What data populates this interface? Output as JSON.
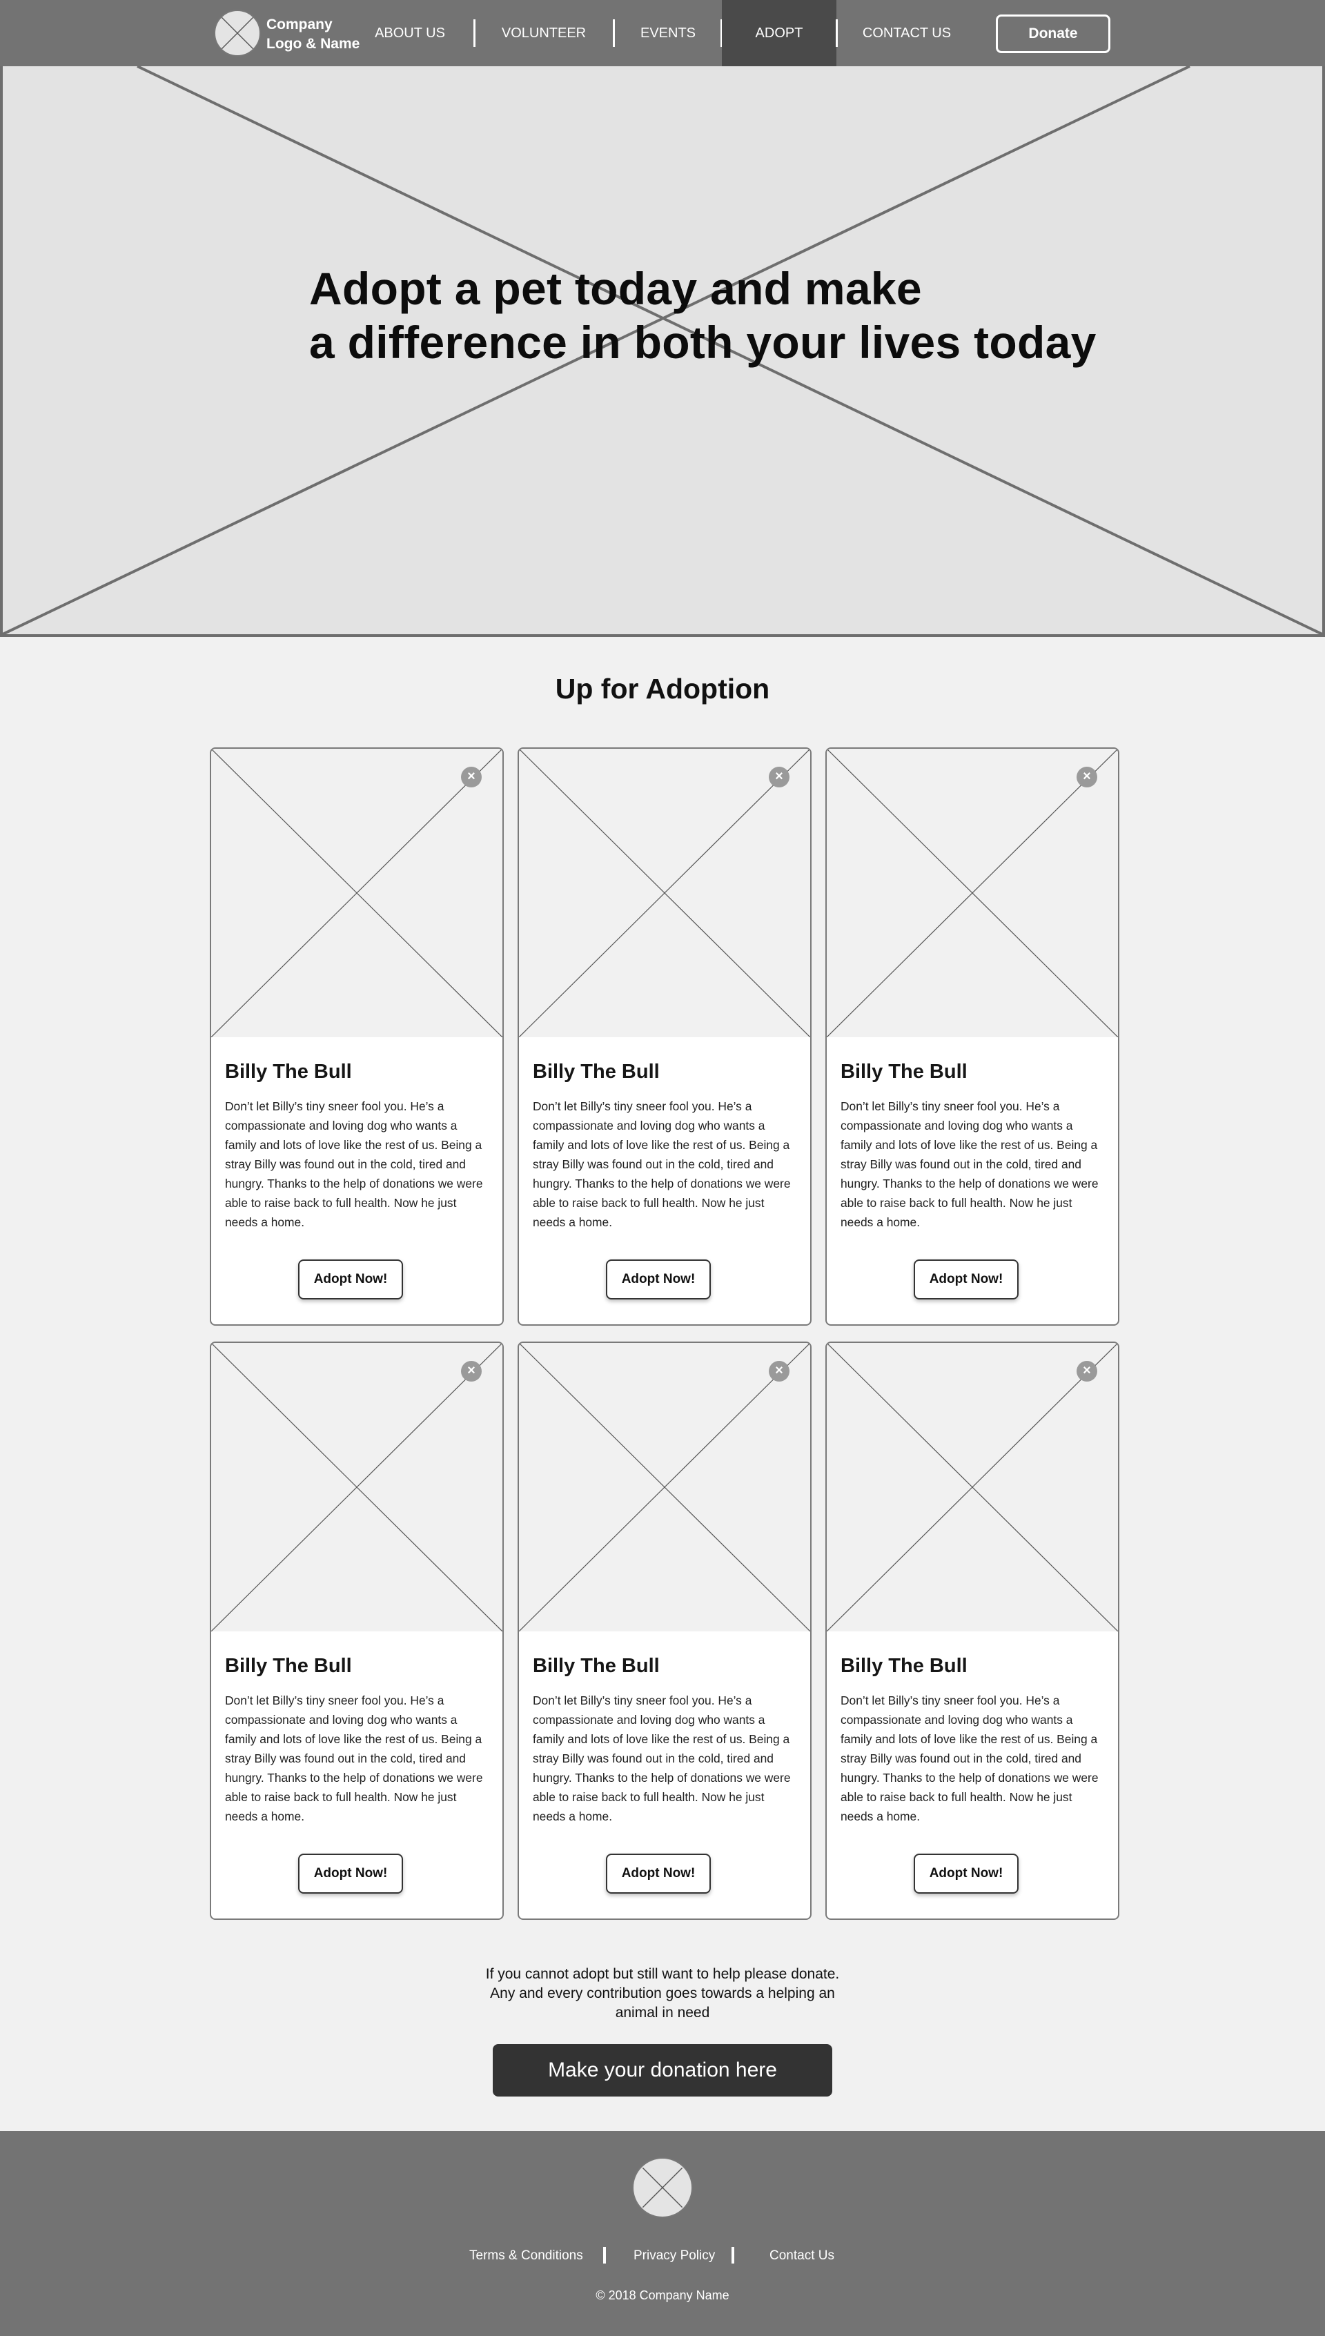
{
  "nav": {
    "logo_text": "Company Logo & Name",
    "items": [
      {
        "label": "ABOUT US"
      },
      {
        "label": "VOLUNTEER"
      },
      {
        "label": "EVENTS"
      },
      {
        "label": "ADOPT",
        "active": true
      },
      {
        "label": "CONTACT US"
      }
    ],
    "donate_label": "Donate"
  },
  "hero": {
    "title_line1": "Adopt a pet today and make",
    "title_line2": "a difference in both your lives today"
  },
  "adoption": {
    "section_title": "Up for Adoption",
    "cards": [
      {
        "name": "Billy The Bull",
        "description": "Don’t let Billy’s tiny sneer fool you. He’s a compassionate and loving dog who wants a family and lots of love like the rest of us. Being a stray Billy was found out in the cold, tired and hungry. Thanks to the help of donations we were able to raise back to full health. Now he just needs a home.",
        "button": "Adopt Now!"
      },
      {
        "name": "Billy The Bull",
        "description": "Don’t let Billy’s tiny sneer fool you. He’s a compassionate and loving dog who wants a family and lots of love like the rest of us. Being a stray Billy was found out in the cold, tired and hungry. Thanks to the help of donations we were able to raise back to full health. Now he just needs a home.",
        "button": "Adopt Now!"
      },
      {
        "name": "Billy The Bull",
        "description": "Don’t let Billy’s tiny sneer fool you. He’s a compassionate and loving dog who wants a family and lots of love like the rest of us. Being a stray Billy was found out in the cold, tired and hungry. Thanks to the help of donations we were able to raise back to full health. Now he just needs a home.",
        "button": "Adopt Now!"
      },
      {
        "name": "Billy The Bull",
        "description": "Don’t let Billy’s tiny sneer fool you. He’s a compassionate and loving dog who wants a family and lots of love like the rest of us. Being a stray Billy was found out in the cold, tired and hungry. Thanks to the help of donations we were able to raise back to full health. Now he just needs a home.",
        "button": "Adopt Now!"
      },
      {
        "name": "Billy The Bull",
        "description": "Don’t let Billy’s tiny sneer fool you. He’s a compassionate and loving dog who wants a family and lots of love like the rest of us. Being a stray Billy was found out in the cold, tired and hungry. Thanks to the help of donations we were able to raise back to full health. Now he just needs a home.",
        "button": "Adopt Now!"
      },
      {
        "name": "Billy The Bull",
        "description": "Don’t let Billy’s tiny sneer fool you. He’s a compassionate and loving dog who wants a family and lots of love like the rest of us. Being a stray Billy was found out in the cold, tired and hungry. Thanks to the help of donations we were able to raise back to full health. Now he just needs a home.",
        "button": "Adopt Now!"
      }
    ]
  },
  "donation": {
    "text": "If you cannot adopt but still want to help please donate. Any and every contribution goes towards a helping an animal in need",
    "button": "Make your donation here"
  },
  "footer": {
    "links": [
      {
        "label": "Terms & Conditions"
      },
      {
        "label": "Privacy Policy"
      },
      {
        "label": "Contact Us"
      }
    ],
    "copyright": "© 2018 Company Name"
  },
  "icons": {
    "logo": "placeholder-image-icon",
    "favorite": "close-circle-icon"
  },
  "colors": {
    "nav_bg": "#737373",
    "nav_active": "#4a4a4a",
    "page_bg": "#f1f1f1",
    "button_dark": "#333333"
  }
}
